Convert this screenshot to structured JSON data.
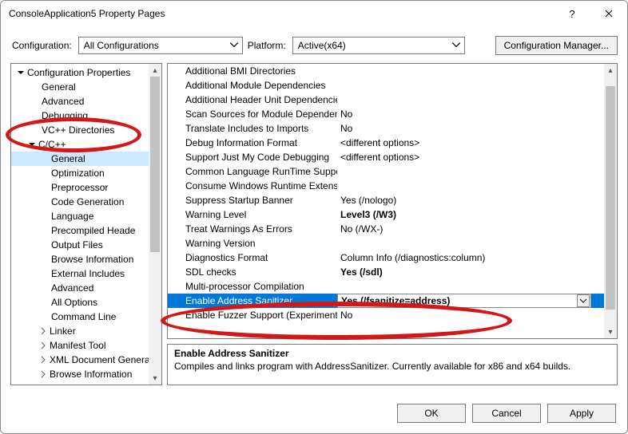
{
  "window": {
    "title": "ConsoleApplication5 Property Pages"
  },
  "toprow": {
    "config_label": "Configuration:",
    "config_value": "All Configurations",
    "platform_label": "Platform:",
    "platform_value": "Active(x64)",
    "manager": "Configuration Manager..."
  },
  "tree": {
    "root": "Configuration Properties",
    "items_top": [
      "General",
      "Advanced",
      "Debugging",
      "VC++ Directories"
    ],
    "cpp": "C/C++",
    "cpp_items": [
      "General",
      "Optimization",
      "Preprocessor",
      "Code Generation",
      "Language",
      "Precompiled Heade",
      "Output Files",
      "Browse Information",
      "External Includes",
      "Advanced",
      "All Options",
      "Command Line"
    ],
    "items_bottom": [
      "Linker",
      "Manifest Tool",
      "XML Document Genera",
      "Browse Information"
    ]
  },
  "grid": [
    {
      "name": "Additional BMI Directories",
      "val": ""
    },
    {
      "name": "Additional Module Dependencies",
      "val": ""
    },
    {
      "name": "Additional Header Unit Dependencies",
      "val": ""
    },
    {
      "name": "Scan Sources for Module Dependencies",
      "val": "No"
    },
    {
      "name": "Translate Includes to Imports",
      "val": "No"
    },
    {
      "name": "Debug Information Format",
      "val": "<different options>"
    },
    {
      "name": "Support Just My Code Debugging",
      "val": "<different options>"
    },
    {
      "name": "Common Language RunTime Support",
      "val": ""
    },
    {
      "name": "Consume Windows Runtime Extension",
      "val": ""
    },
    {
      "name": "Suppress Startup Banner",
      "val": "Yes (/nologo)"
    },
    {
      "name": "Warning Level",
      "val": "Level3 (/W3)",
      "bold": true
    },
    {
      "name": "Treat Warnings As Errors",
      "val": "No (/WX-)"
    },
    {
      "name": "Warning Version",
      "val": ""
    },
    {
      "name": "Diagnostics Format",
      "val": "Column Info (/diagnostics:column)"
    },
    {
      "name": "SDL checks",
      "val": "Yes (/sdl)",
      "bold": true
    },
    {
      "name": "Multi-processor Compilation",
      "val": ""
    },
    {
      "name": "Enable Address Sanitizer",
      "val": "Yes (/fsanitize=address)",
      "bold": true,
      "selected": true
    },
    {
      "name": "Enable Fuzzer Support (Experimental)",
      "val": "No"
    }
  ],
  "desc": {
    "title": "Enable Address Sanitizer",
    "text": "Compiles and links program with AddressSanitizer. Currently available for x86 and x64 builds."
  },
  "footer": {
    "ok": "OK",
    "cancel": "Cancel",
    "apply": "Apply"
  }
}
